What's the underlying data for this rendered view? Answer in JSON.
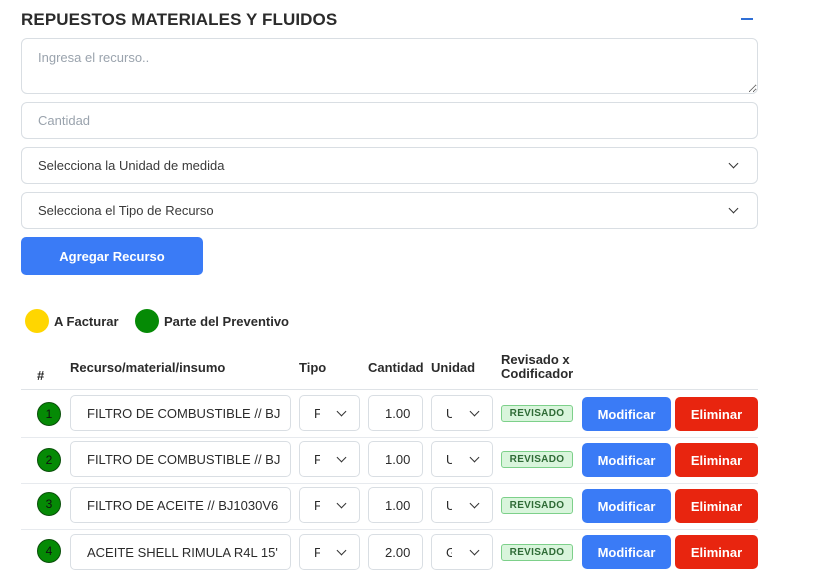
{
  "section": {
    "title": "REPUESTOS MATERIALES Y FLUIDOS",
    "collapse_icon": "minus-icon"
  },
  "form": {
    "resource_placeholder": "Ingresa el recurso..",
    "quantity_placeholder": "Cantidad",
    "unit_select": "Selecciona la Unidad de medida",
    "type_select": "Selecciona el Tipo de Recurso",
    "add_button": "Agregar Recurso"
  },
  "legend": [
    {
      "label": "A Facturar",
      "color": "#ffd600"
    },
    {
      "label": "Parte del Preventivo",
      "color": "#058a05"
    }
  ],
  "table": {
    "headers": {
      "num": "#",
      "resource": "Recurso/material/insumo",
      "type": "Tipo",
      "quantity": "Cantidad",
      "unit": "Unidad",
      "reviewed_line1": "Revisado x",
      "reviewed_line2": "Codificador"
    },
    "rows": [
      {
        "num": "1",
        "resource": "FILTRO DE COMBUSTIBLE //  BJ",
        "type": "F",
        "quantity": "1.00",
        "unit": "U",
        "status": "REVISADO",
        "modify": "Modificar",
        "delete": "Eliminar"
      },
      {
        "num": "2",
        "resource": "FILTRO DE COMBUSTIBLE //  BJ",
        "type": "F",
        "quantity": "1.00",
        "unit": "U",
        "status": "REVISADO",
        "modify": "Modificar",
        "delete": "Eliminar"
      },
      {
        "num": "3",
        "resource": "FILTRO DE ACEITE //  BJ1030V6",
        "type": "F",
        "quantity": "1.00",
        "unit": "U",
        "status": "REVISADO",
        "modify": "Modificar",
        "delete": "Eliminar"
      },
      {
        "num": "4",
        "resource": "ACEITE SHELL RIMULA R4L 15'",
        "type": "F",
        "quantity": "2.00",
        "unit": "G",
        "status": "REVISADO",
        "modify": "Modificar",
        "delete": "Eliminar"
      }
    ]
  },
  "colors": {
    "primary": "#3a7bf6",
    "danger": "#e8250f",
    "status_badge_bg": "#d9f5dc",
    "row_marker": "#058a05"
  }
}
